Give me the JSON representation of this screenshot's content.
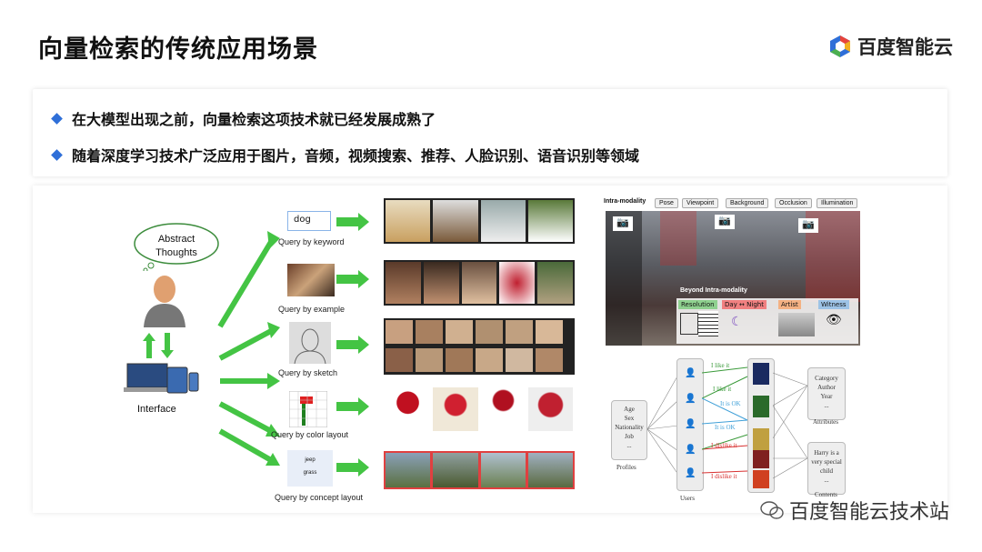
{
  "slide": {
    "title": "向量检索的传统应用场景",
    "brand": "百度智能云"
  },
  "bullets": [
    "在大模型出现之前，向量检索这项技术就已经发展成熟了",
    "随着深度学习技术广泛应用于图片，音频，视频搜索、推荐、人脸识别、语音识别等领域"
  ],
  "left_figure": {
    "thought": [
      "Abstract",
      "Thoughts"
    ],
    "interface_label": "Interface",
    "keyword_value": "dog",
    "concept_words": [
      "jeep",
      "grass"
    ],
    "queries": [
      "Query by keyword",
      "Query by example",
      "Query by sketch",
      "Query by color layout",
      "Query by concept layout"
    ]
  },
  "right_top": {
    "intra_label": "Intra-modality",
    "tags": [
      "Pose",
      "Viewpoint",
      "Background",
      "Occlusion",
      "Illumination"
    ],
    "beyond_label": "Beyond Intra-modality",
    "beyond_tags": [
      "Resolution",
      "Day ↔ Night",
      "Artist",
      "Witness"
    ],
    "beyond_colors": [
      "#8fd18f",
      "#f08080",
      "#f4b183",
      "#9dc3e6"
    ]
  },
  "right_bottom": {
    "profiles": [
      "Age",
      "Sex",
      "Nationality",
      "Job",
      "..."
    ],
    "profiles_label": "Profiles",
    "users_label": "Users",
    "attributes": [
      "Category",
      "Author",
      "Year",
      "..."
    ],
    "attributes_label": "Attributes",
    "contents": [
      "Harry is a",
      "very special",
      "child",
      "..."
    ],
    "contents_label": "Contents",
    "edges": [
      "I like it",
      "I like it",
      "It is OK",
      "It is OK",
      "I dislike it",
      "I dislike it"
    ]
  },
  "watermark": "百度智能云技术站"
}
